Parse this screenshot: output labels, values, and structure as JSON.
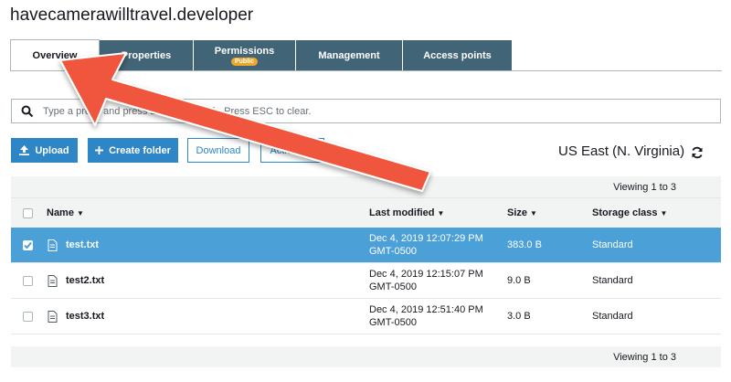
{
  "bucket": {
    "title": "havecamerawilltravel.developer"
  },
  "tabs": [
    {
      "label": "Overview",
      "active": true
    },
    {
      "label": "Properties"
    },
    {
      "label": "Permissions",
      "badge": "Public"
    },
    {
      "label": "Management"
    },
    {
      "label": "Access points"
    }
  ],
  "search": {
    "placeholder": "Type a prefix and press Enter to search. Press ESC to clear."
  },
  "toolbar": {
    "upload_label": "Upload",
    "create_folder_label": "Create folder",
    "download_label": "Download",
    "actions_label": "Actions",
    "region": "US East (N. Virginia)"
  },
  "table": {
    "viewing_top": "Viewing 1 to 3",
    "viewing_bottom": "Viewing 1 to 3",
    "columns": {
      "name": "Name",
      "modified": "Last modified",
      "size": "Size",
      "storage": "Storage class"
    },
    "rows": [
      {
        "name": "test.txt",
        "modified_date": "Dec 4, 2019 12:07:29 PM",
        "modified_tz": "GMT-0500",
        "size": "383.0 B",
        "storage": "Standard",
        "selected": true
      },
      {
        "name": "test2.txt",
        "modified_date": "Dec 4, 2019 12:15:07 PM",
        "modified_tz": "GMT-0500",
        "size": "9.0 B",
        "storage": "Standard",
        "selected": false
      },
      {
        "name": "test3.txt",
        "modified_date": "Dec 4, 2019 12:51:40 PM",
        "modified_tz": "GMT-0500",
        "size": "3.0 B",
        "storage": "Standard",
        "selected": false
      }
    ]
  },
  "icons": {
    "search": "search-icon",
    "upload": "upload-icon",
    "create_folder": "plus-icon",
    "refresh": "refresh-icon",
    "file": "file-icon",
    "sort": "caret-down-icon"
  },
  "colors": {
    "tab_bg": "#426477",
    "badge": "#f0a626",
    "primary": "#2e86c7",
    "selected_row": "#4ba0d7",
    "annotation_arrow": "#f0543c"
  }
}
